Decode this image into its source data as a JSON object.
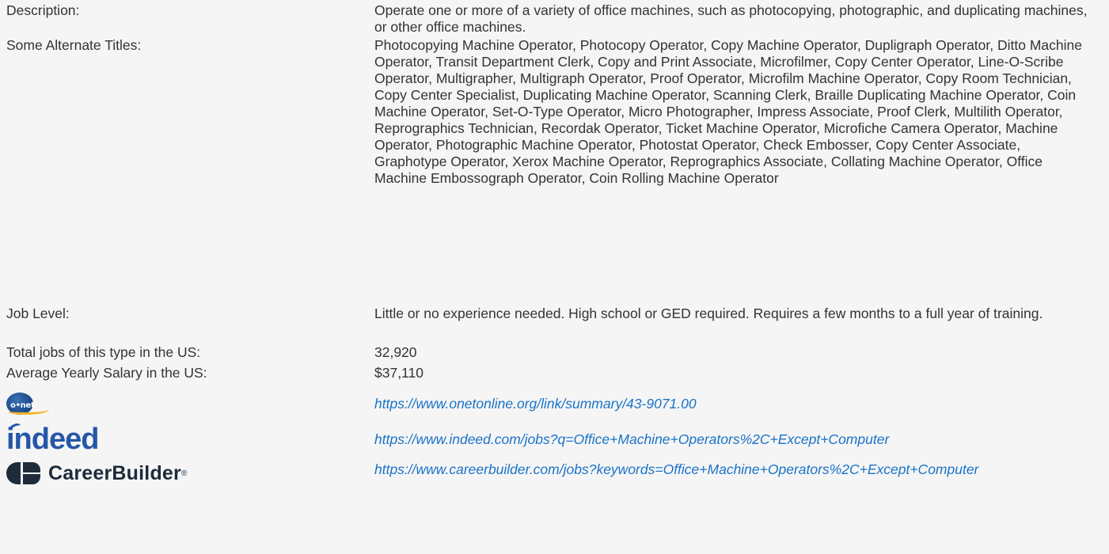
{
  "rows": [
    {
      "label": "Description:",
      "value": "Operate one or more of a variety of office machines, such as photocopying, photographic, and duplicating machines, or other office machines."
    },
    {
      "label": "Some Alternate Titles:",
      "value": "Photocopying Machine Operator, Photocopy Operator, Copy Machine Operator, Dupligraph Operator, Ditto Machine Operator, Transit Department Clerk, Copy and Print Associate, Microfilmer, Copy Center Operator, Line-O-Scribe Operator, Multigrapher, Multigraph Operator, Proof Operator, Microfilm Machine Operator, Copy Room Technician, Copy Center Specialist, Duplicating Machine Operator, Scanning Clerk, Braille Duplicating Machine Operator, Coin Machine Operator, Set-O-Type Operator, Micro Photographer, Impress Associate, Proof Clerk, Multilith Operator, Reprographics Technician, Recordak Operator, Ticket Machine Operator, Microfiche Camera Operator, Machine Operator, Photographic Machine Operator, Photostat Operator, Check Embosser, Copy Center Associate, Graphotype Operator, Xerox Machine Operator, Reprographics Associate, Collating Machine Operator, Office Machine Embossograph Operator, Coin Rolling Machine Operator"
    },
    {
      "label": "Job Level:",
      "value": "Little or no experience needed. High school or GED required. Requires a few months to a full year of training."
    },
    {
      "label": "Total jobs of this type in the US:",
      "value": "32,920"
    },
    {
      "label": "Average Yearly Salary in the US:",
      "value": "$37,110"
    }
  ],
  "links": {
    "onet": {
      "logo_text": "o•net",
      "url": "https://www.onetonline.org/link/summary/43-9071.00"
    },
    "indeed": {
      "logo_text": "indeed",
      "url": "https://www.indeed.com/jobs?q=Office+Machine+Operators%2C+Except+Computer"
    },
    "careerbuilder": {
      "logo_text": "CareerBuilder",
      "logo_reg": "®",
      "url": "https://www.careerbuilder.com/jobs?keywords=Office+Machine+Operators%2C+Except+Computer"
    }
  },
  "colors": {
    "background": "#f5f5f5",
    "text": "#333333",
    "link": "#1a73c8",
    "indeed_blue": "#2557a7",
    "careerbuilder_navy": "#1d2b3a",
    "onet_gold": "#f4b223"
  }
}
